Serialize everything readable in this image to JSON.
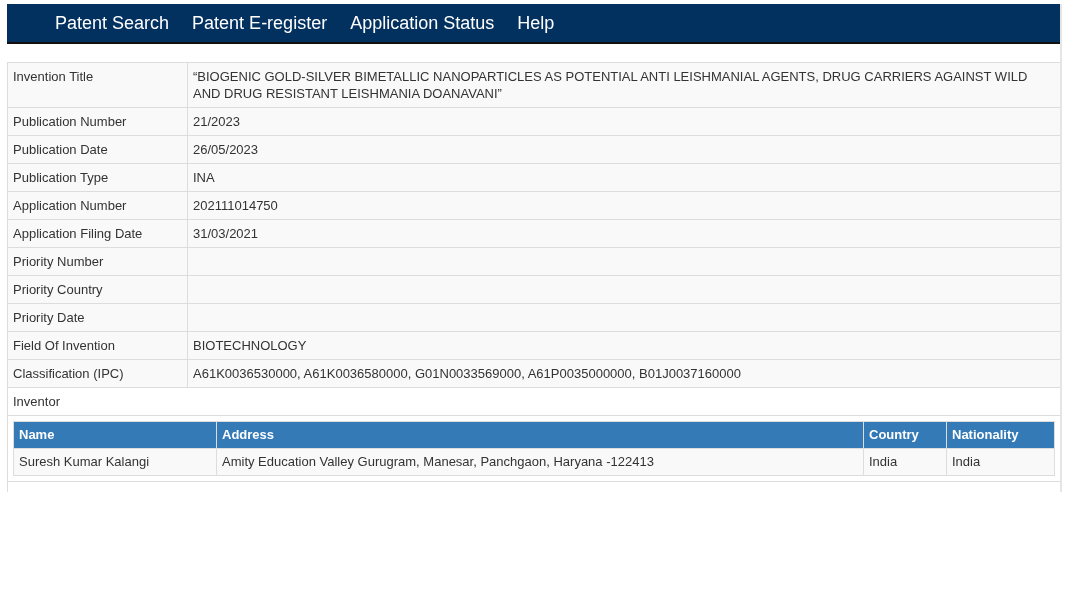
{
  "nav": [
    "Patent Search",
    "Patent E-register",
    "Application Status",
    "Help"
  ],
  "details": [
    {
      "label": "Invention Title",
      "value": "“BIOGENIC GOLD-SILVER BIMETALLIC NANOPARTICLES AS POTENTIAL ANTI LEISHMANIAL AGENTS, DRUG CARRIERS AGAINST WILD AND DRUG RESISTANT LEISHMANIA DOANAVANI”"
    },
    {
      "label": "Publication Number",
      "value": "21/2023"
    },
    {
      "label": "Publication Date",
      "value": "26/05/2023"
    },
    {
      "label": "Publication Type",
      "value": "INA"
    },
    {
      "label": "Application Number",
      "value": "202111014750"
    },
    {
      "label": "Application Filing Date",
      "value": "31/03/2021"
    },
    {
      "label": "Priority Number"
    },
    {
      "label": "Priority Country"
    },
    {
      "label": "Priority Date"
    },
    {
      "label": "Field Of Invention",
      "value": "BIOTECHNOLOGY"
    },
    {
      "label": "Classification (IPC)",
      "value": "A61K0036530000, A61K0036580000, G01N0033569000, A61P0035000000, B01J0037160000"
    }
  ],
  "inventor": {
    "heading": "Inventor",
    "columns": [
      "Name",
      "Address",
      "Country",
      "Nationality"
    ],
    "rows": [
      [
        "Suresh Kumar Kalangi",
        "Amity Education Valley Gurugram, Manesar, Panchgaon, Haryana -122413",
        "India",
        "India"
      ]
    ]
  }
}
